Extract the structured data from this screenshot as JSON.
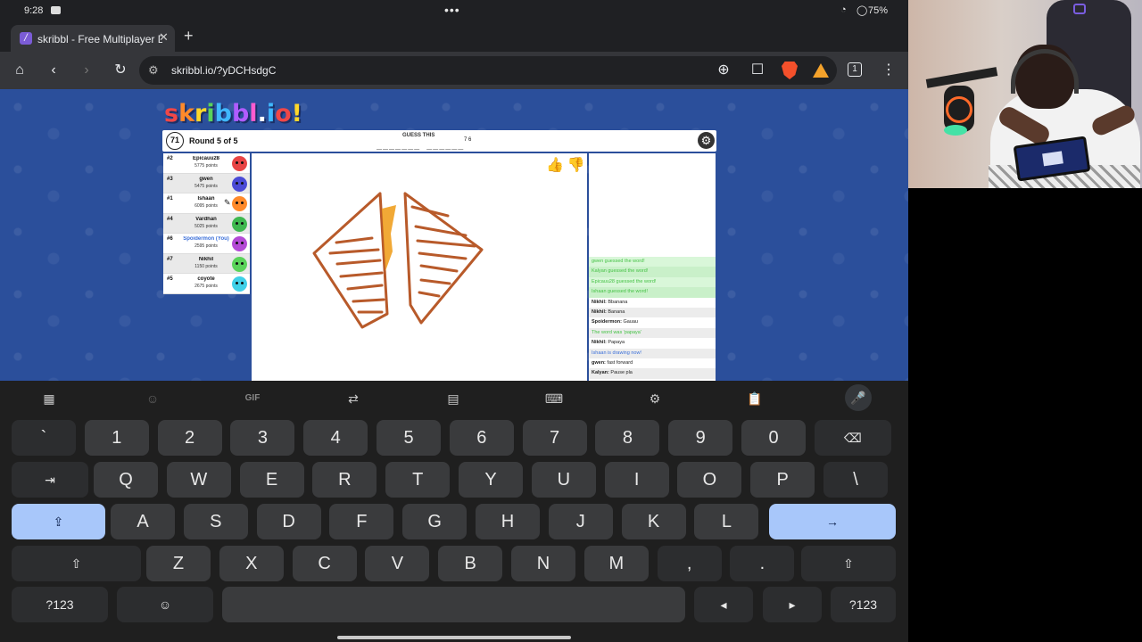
{
  "status_bar": {
    "time": "9:28",
    "dots": "•••",
    "battery": "75%"
  },
  "browser": {
    "tab_title": "skribbl - Free Multiplayer Drawing & Guessing Game",
    "favicon_letter": "/",
    "new_tab": "+",
    "tab_close": "✕",
    "url": "skribbl.io/?yDCHsdgC",
    "tab_count": "1"
  },
  "game": {
    "logo_parts": [
      "s",
      "k",
      "r",
      "i",
      "b",
      "b",
      "l",
      ".",
      "i",
      "o",
      "!"
    ],
    "timer": "71",
    "round": "Round 5 of 5",
    "guess_label": "GUESS THIS",
    "word_hint": "_______ ______",
    "word_lengths": "7 6",
    "players": [
      {
        "rank": "#2",
        "name": "Epicauu28",
        "points": "5775 points",
        "color": "#e84444",
        "you": false,
        "drawing": false
      },
      {
        "rank": "#3",
        "name": "gwen",
        "points": "5475 points",
        "color": "#4a4ad6",
        "you": false,
        "drawing": false
      },
      {
        "rank": "#1",
        "name": "Ishaan",
        "points": "6095 points",
        "color": "#ff8a2a",
        "you": false,
        "drawing": true
      },
      {
        "rank": "#4",
        "name": "Vardhan",
        "points": "5025 points",
        "color": "#3fb84f",
        "you": false,
        "drawing": false
      },
      {
        "rank": "#6",
        "name": "Spoidermon (You)",
        "points": "2595 points",
        "color": "#b44ad6",
        "you": true,
        "drawing": false
      },
      {
        "rank": "#7",
        "name": "Nikhil",
        "points": "1150 points",
        "color": "#5ad35a",
        "you": false,
        "drawing": false
      },
      {
        "rank": "#5",
        "name": "coyote",
        "points": "2675 points",
        "color": "#3fd0e8",
        "you": false,
        "drawing": false
      }
    ],
    "chat": [
      {
        "type": "green",
        "author": "",
        "text": "gwen guessed the word!"
      },
      {
        "type": "green",
        "author": "",
        "text": "Kalyan guessed the word!"
      },
      {
        "type": "green",
        "author": "",
        "text": "Epicauu28 guessed the word!"
      },
      {
        "type": "green",
        "author": "",
        "text": "Ishaan guessed the word!"
      },
      {
        "type": "normal",
        "author": "Nikhil:",
        "text": "Bbanana"
      },
      {
        "type": "normal",
        "author": "Nikhil:",
        "text": "Banana"
      },
      {
        "type": "normal",
        "author": "Spoidermon:",
        "text": "Gauau"
      },
      {
        "type": "sys",
        "author": "",
        "text": "The word was 'papaya'"
      },
      {
        "type": "normal",
        "author": "Nikhil:",
        "text": "Papaya"
      },
      {
        "type": "blue",
        "author": "",
        "text": "Ishaan is drawing now!"
      },
      {
        "type": "normal",
        "author": "gwen:",
        "text": "fast forward"
      },
      {
        "type": "normal",
        "author": "Kalyan:",
        "text": "Pause pla"
      }
    ]
  },
  "keyboard": {
    "gif_label": "GIF",
    "row1": [
      "`",
      "1",
      "2",
      "3",
      "4",
      "5",
      "6",
      "7",
      "8",
      "9",
      "0"
    ],
    "row2": [
      "Q",
      "W",
      "E",
      "R",
      "T",
      "Y",
      "U",
      "I",
      "O",
      "P",
      "\\"
    ],
    "row3": [
      "A",
      "S",
      "D",
      "F",
      "G",
      "H",
      "J",
      "K",
      "L"
    ],
    "row4": [
      "Z",
      "X",
      "C",
      "V",
      "B",
      "N",
      "M",
      ",",
      "."
    ],
    "symbols_label": "?123"
  }
}
